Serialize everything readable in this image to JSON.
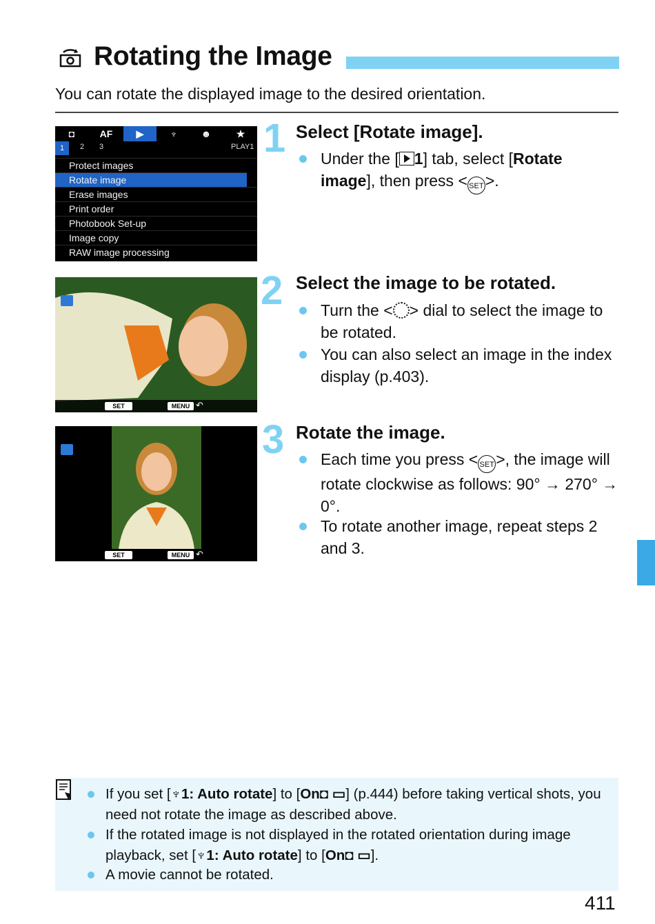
{
  "header": {
    "title": "Rotating the Image",
    "intro": "You can rotate the displayed image to the desired orientation."
  },
  "menu_screen": {
    "tabs": [
      "◘",
      "AF",
      "▶",
      "♆",
      "☻",
      "★"
    ],
    "tab_numbers": [
      "1",
      "2",
      "3"
    ],
    "tab_tag": "PLAY1",
    "items": [
      "Protect images",
      "Rotate image",
      "Erase images",
      "Print order",
      "Photobook Set-up",
      "Image copy",
      "RAW image processing"
    ],
    "selected_index": 1
  },
  "screens": {
    "set_label": "SET",
    "menu_label": "MENU",
    "back_glyph": "↶"
  },
  "steps": [
    {
      "number": "1",
      "title": "Select [Rotate image].",
      "bullet1": {
        "a": "Under the [",
        "b": "1",
        "c": "] tab, select [",
        "d": "Rotate image",
        "e": "], then press <",
        "f": ">."
      }
    },
    {
      "number": "2",
      "title": "Select the image to be rotated.",
      "bullet1": {
        "a": "Turn the <",
        "b": "> dial to select the image to be rotated."
      },
      "bullet2": "You can also select an image in the index display (p.403)."
    },
    {
      "number": "3",
      "title": "Rotate the image.",
      "bullet1": {
        "a": "Each time you press <",
        "b": ">, the image will rotate clockwise as follows: 90° → 270° → 0°."
      },
      "bullet2": "To rotate another image, repeat steps 2 and 3."
    }
  ],
  "set_icon_label": "SET",
  "note": {
    "item1": {
      "a": "If you set [",
      "b": "♆1: Auto rotate",
      "c": "] to [",
      "d": "On◘ ▭",
      "e": "] (p.444) before taking vertical shots, you need not rotate the image as described above."
    },
    "item2": {
      "a": "If the rotated image is not displayed in the rotated orientation during image playback, set [",
      "b": "♆1: Auto rotate",
      "c": "] to [",
      "d": "On◘ ▭",
      "e": "]."
    },
    "item3": "A movie cannot be rotated."
  },
  "page_number": "411",
  "colors": {
    "accent": "#7fd2f4",
    "bullet": "#6cc7ef",
    "side_tab": "#3aa9e6",
    "note_bg": "#e9f6fc",
    "menu_highlight": "#1f64c6"
  }
}
